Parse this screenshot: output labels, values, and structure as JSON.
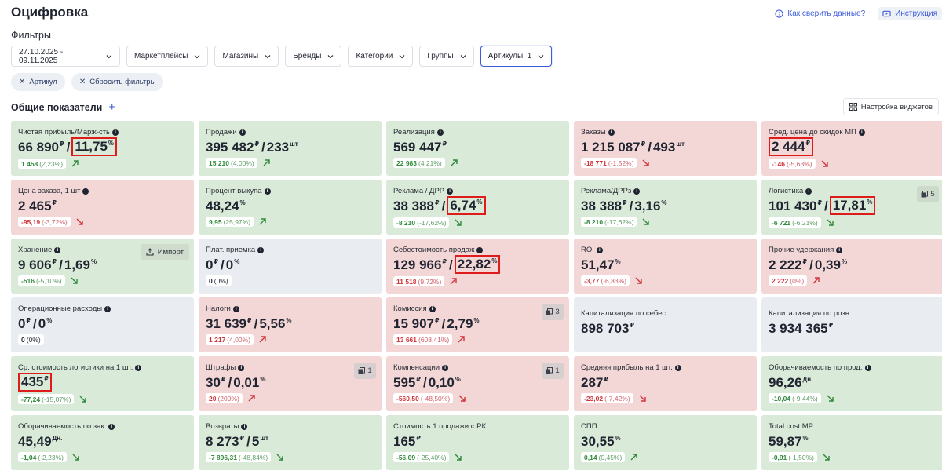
{
  "header": {
    "title": "Оцифровка",
    "link_verify": "Как сверить данные?",
    "link_instructions": "Инструкция"
  },
  "filters": {
    "label": "Фильтры",
    "date_range": "27.10.2025 - 09.11.2025",
    "marketplaces": "Маркетплейсы",
    "stores": "Магазины",
    "brands": "Бренды",
    "categories": "Категории",
    "groups": "Группы",
    "articles": "Артикулы: 1"
  },
  "chips": {
    "article": "Артикул",
    "reset": "Сбросить фильтры"
  },
  "section": {
    "title": "Общие показатели",
    "widget_settings": "Настройка виджетов"
  },
  "cards": [
    {
      "title": "Чистая прибыль/Марж-сть",
      "v1": "66 890",
      "u1": "₽",
      "v2": "11,75",
      "u2": "%",
      "box": "v2",
      "delta": "1 458",
      "pct": "(2,23%)",
      "tone": "pos",
      "trend": "up",
      "color": "green"
    },
    {
      "title": "Продажи",
      "v1": "395 482",
      "u1": "₽",
      "v2": "233",
      "u2": "шт",
      "delta": "15 210",
      "pct": "(4,00%)",
      "tone": "pos",
      "trend": "up",
      "color": "green"
    },
    {
      "title": "Реализация",
      "v1": "569 447",
      "u1": "₽",
      "delta": "22 983",
      "pct": "(4,21%)",
      "tone": "pos",
      "trend": "up",
      "color": "green"
    },
    {
      "title": "Заказы",
      "v1": "1 215 087",
      "u1": "₽",
      "v2": "493",
      "u2": "шт",
      "delta": "-18 771",
      "pct": "(-1,52%)",
      "tone": "neg",
      "trend": "down",
      "color": "red"
    },
    {
      "title": "Сред. цена до скидок МП",
      "v1": "2 444",
      "u1": "₽",
      "box": "v1",
      "delta": "-146",
      "pct": "(-5,63%)",
      "tone": "neg",
      "trend": "down",
      "color": "red"
    },
    {
      "title": "Цена заказа, 1 шт",
      "v1": "2 465",
      "u1": "₽",
      "delta": "-95,19",
      "pct": "(-3,72%)",
      "tone": "neg",
      "trend": "down",
      "color": "red"
    },
    {
      "title": "Процент выкупа",
      "v1": "48,24",
      "u1": "%",
      "delta": "9,95",
      "pct": "(25,97%)",
      "tone": "pos",
      "trend": "up",
      "color": "green"
    },
    {
      "title": "Реклама / ДРР",
      "v1": "38 388",
      "u1": "₽",
      "v2": "6,74",
      "u2": "%",
      "box": "v2",
      "delta": "-8 210",
      "pct": "(-17,62%)",
      "tone": "pos",
      "trend": "down",
      "color": "green"
    },
    {
      "title": "Реклама/ДРРз",
      "v1": "38 388",
      "u1": "₽",
      "v2": "3,16",
      "u2": "%",
      "delta": "-8 210",
      "pct": "(-17,62%)",
      "tone": "pos",
      "trend": "down",
      "color": "green"
    },
    {
      "title": "Логистика",
      "v1": "101 430",
      "u1": "₽",
      "v2": "17,81",
      "u2": "%",
      "box": "v2",
      "delta": "-6 721",
      "pct": "(-6,21%)",
      "tone": "pos",
      "trend": "down",
      "color": "green",
      "badge": "5"
    },
    {
      "title": "Хранение",
      "v1": "9 606",
      "u1": "₽",
      "v2": "1,69",
      "u2": "%",
      "delta": "-516",
      "pct": "(-5,10%)",
      "tone": "pos",
      "trend": "down",
      "color": "green",
      "import": "Импорт"
    },
    {
      "title": "Плат. приемка",
      "v1": "0",
      "u1": "₽",
      "v2": "0",
      "u2": "%",
      "delta": "0",
      "pct": "(0%)",
      "tone": "neu",
      "trend": "none",
      "color": "grey"
    },
    {
      "title": "Себестоимость продаж",
      "v1": "129 966",
      "u1": "₽",
      "v2": "22,82",
      "u2": "%",
      "box": "v2",
      "delta": "11 518",
      "pct": "(9,72%)",
      "tone": "neg",
      "trend": "up",
      "color": "red"
    },
    {
      "title": "ROI",
      "v1": "51,47",
      "u1": "%",
      "delta": "-3,77",
      "pct": "(-6,83%)",
      "tone": "neg",
      "trend": "down",
      "color": "red"
    },
    {
      "title": "Прочие удержания",
      "v1": "2 222",
      "u1": "₽",
      "v2": "0,39",
      "u2": "%",
      "delta": "2 222",
      "pct": "(0%)",
      "tone": "neg",
      "trend": "up",
      "color": "red"
    },
    {
      "title": "Операционные расходы",
      "v1": "0",
      "u1": "₽",
      "v2": "0",
      "u2": "%",
      "delta": "0",
      "pct": "(0%)",
      "tone": "neu",
      "trend": "none",
      "color": "grey"
    },
    {
      "title": "Налоги",
      "v1": "31 639",
      "u1": "₽",
      "v2": "5,56",
      "u2": "%",
      "delta": "1 217",
      "pct": "(4,00%)",
      "tone": "neg",
      "trend": "up",
      "color": "red"
    },
    {
      "title": "Комиссия",
      "v1": "15 907",
      "u1": "₽",
      "v2": "2,79",
      "u2": "%",
      "delta": "13 661",
      "pct": "(608,41%)",
      "tone": "neg",
      "trend": "up",
      "color": "red",
      "badge": "3"
    },
    {
      "title": "Капитализация по себес.",
      "v1": "898 703",
      "u1": "₽",
      "color": "grey",
      "center": true,
      "noinfo": true
    },
    {
      "title": "Капитализация по розн.",
      "v1": "3 934 365",
      "u1": "₽",
      "color": "grey",
      "center": true,
      "noinfo": true
    },
    {
      "title": "Ср. стоимость логистики на 1 шт.",
      "v1": "435",
      "u1": "₽",
      "box": "v1",
      "delta": "-77,24",
      "pct": "(-15,07%)",
      "tone": "pos",
      "trend": "down",
      "color": "green"
    },
    {
      "title": "Штрафы",
      "v1": "30",
      "u1": "₽",
      "v2": "0,01",
      "u2": "%",
      "delta": "20",
      "pct": "(200%)",
      "tone": "neg",
      "trend": "up",
      "color": "red",
      "badge": "1"
    },
    {
      "title": "Компенсации",
      "v1": "595",
      "u1": "₽",
      "v2": "0,10",
      "u2": "%",
      "delta": "-560,50",
      "pct": "(-48,50%)",
      "tone": "neg",
      "trend": "down",
      "color": "red",
      "badge": "1"
    },
    {
      "title": "Средняя прибыль на 1 шт.",
      "v1": "287",
      "u1": "₽",
      "delta": "-23,02",
      "pct": "(-7,42%)",
      "tone": "neg",
      "trend": "down",
      "color": "red"
    },
    {
      "title": "Оборачиваемость по прод.",
      "v1": "96,26",
      "u1": "Дн.",
      "delta": "-10,04",
      "pct": "(-9,44%)",
      "tone": "pos",
      "trend": "down",
      "color": "green"
    },
    {
      "title": "Оборачиваемость по зак.",
      "v1": "45,49",
      "u1": "Дн.",
      "delta": "-1,04",
      "pct": "(-2,23%)",
      "tone": "pos",
      "trend": "down",
      "color": "green"
    },
    {
      "title": "Возвраты",
      "v1": "8 273",
      "u1": "₽",
      "v2": "5",
      "u2": "шт",
      "delta": "-7 896,31",
      "pct": "(-48,84%)",
      "tone": "pos",
      "trend": "down",
      "color": "green"
    },
    {
      "title": "Стоимость 1 продажи с РК",
      "v1": "165",
      "u1": "₽",
      "delta": "-56,09",
      "pct": "(-25,40%)",
      "tone": "pos",
      "trend": "down",
      "color": "green",
      "noinfo": true
    },
    {
      "title": "СПП",
      "v1": "30,55",
      "u1": "%",
      "delta": "0,14",
      "pct": "(0,45%)",
      "tone": "pos",
      "trend": "up",
      "color": "green",
      "noinfo": true
    },
    {
      "title": "Total cost MP",
      "v1": "59,87",
      "u1": "%",
      "delta": "-0,91",
      "pct": "(-1,50%)",
      "tone": "pos",
      "trend": "down",
      "color": "green",
      "noinfo": true
    }
  ]
}
